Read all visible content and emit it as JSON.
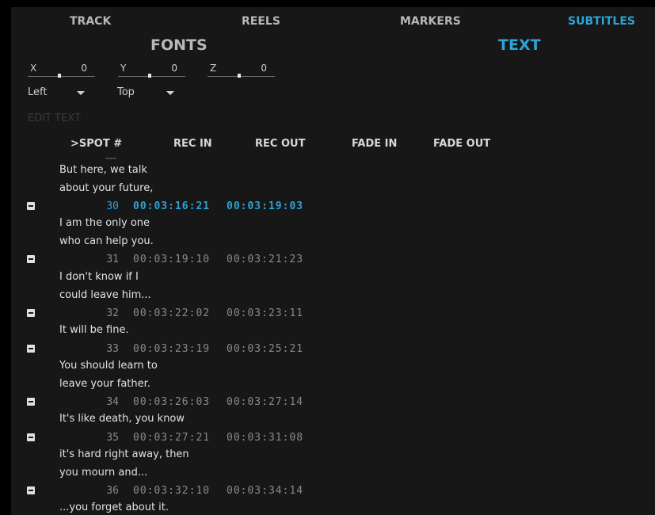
{
  "tabs": [
    {
      "label": "TRACK",
      "active": false
    },
    {
      "label": "REELS",
      "active": false
    },
    {
      "label": "MARKERS",
      "active": false
    },
    {
      "label": "SUBTITLES",
      "active": true
    }
  ],
  "subtabs": [
    {
      "label": "FONTS",
      "active": false
    },
    {
      "label": "TEXT",
      "active": true
    }
  ],
  "position": {
    "x": {
      "label": "X",
      "value": "0"
    },
    "y": {
      "label": "Y",
      "value": "0"
    },
    "z": {
      "label": "Z",
      "value": "0"
    }
  },
  "align": {
    "horizontal": "Left",
    "vertical": "Top"
  },
  "edit_text_label": "EDIT TEXT",
  "columns": {
    "spot": ">SPOT #",
    "rec_in": "REC IN",
    "rec_out": "REC OUT",
    "fade_in": "FADE IN",
    "fade_out": "FADE OUT"
  },
  "colors": {
    "accent": "#2ea3d6",
    "panel": "#171717",
    "text": "#d8d8d8"
  },
  "list": {
    "texts": [
      [
        "But here, we talk",
        "about your future,"
      ],
      [
        "I am the only one",
        "who can help you."
      ],
      [
        "I don't know if I",
        "could leave him..."
      ],
      [
        "It will be fine."
      ],
      [
        "You should learn to",
        "leave your father."
      ],
      [
        "It's like death, you know"
      ],
      [
        "it's hard right away, then",
        "you mourn and..."
      ],
      [
        "...you forget about it."
      ]
    ],
    "rows": [
      {
        "spot": "30",
        "rec_in": "00:03:16:21",
        "rec_out": "00:03:19:03",
        "selected": true
      },
      {
        "spot": "31",
        "rec_in": "00:03:19:10",
        "rec_out": "00:03:21:23",
        "selected": false
      },
      {
        "spot": "32",
        "rec_in": "00:03:22:02",
        "rec_out": "00:03:23:11",
        "selected": false
      },
      {
        "spot": "33",
        "rec_in": "00:03:23:19",
        "rec_out": "00:03:25:21",
        "selected": false
      },
      {
        "spot": "34",
        "rec_in": "00:03:26:03",
        "rec_out": "00:03:27:14",
        "selected": false
      },
      {
        "spot": "35",
        "rec_in": "00:03:27:21",
        "rec_out": "00:03:31:08",
        "selected": false
      },
      {
        "spot": "36",
        "rec_in": "00:03:32:10",
        "rec_out": "00:03:34:14",
        "selected": false
      }
    ]
  }
}
